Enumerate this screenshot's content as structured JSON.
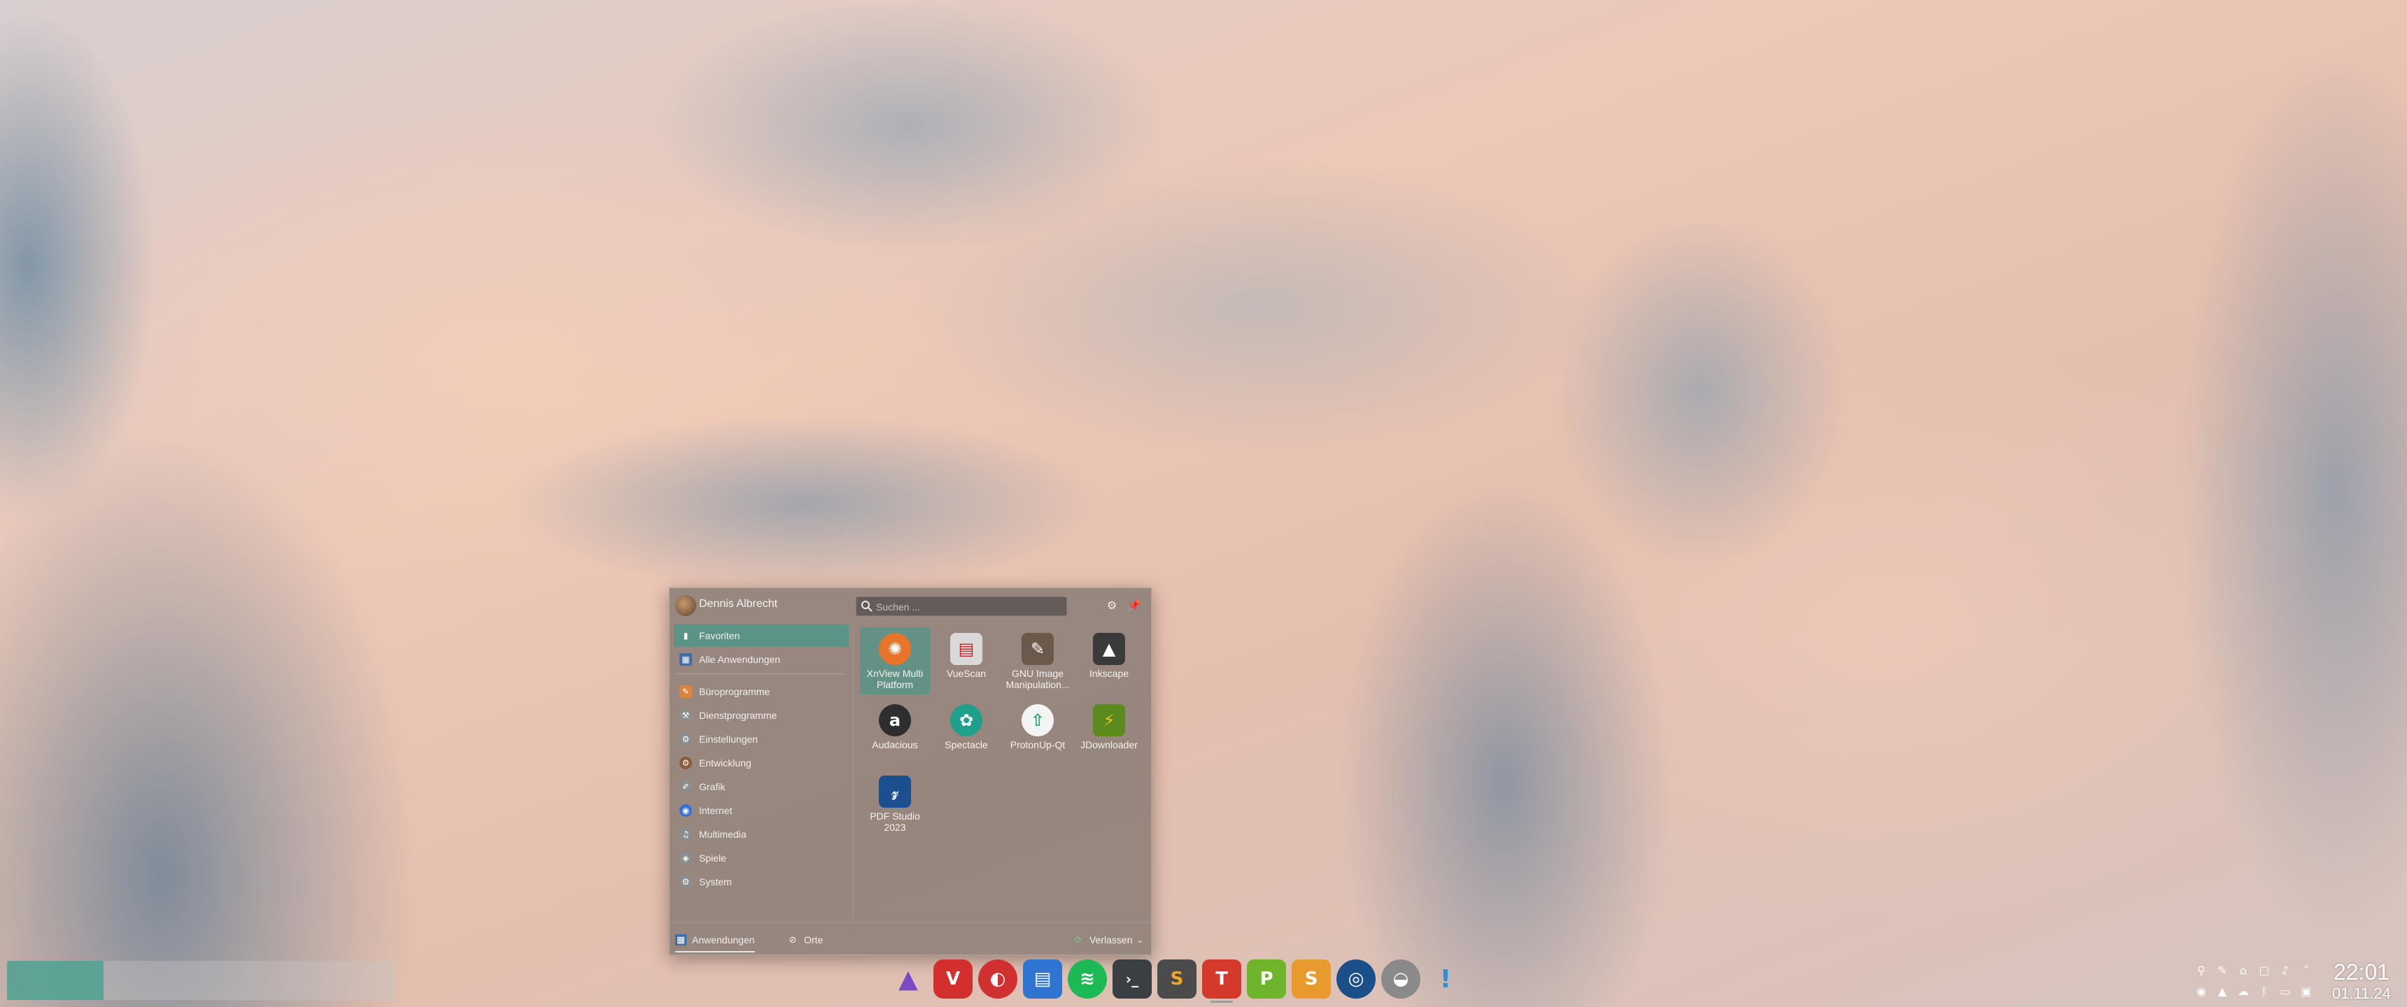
{
  "menu": {
    "user_name": "Dennis Albrecht",
    "search_placeholder": "Suchen ...",
    "header_buttons": [
      {
        "icon": "gear-icon"
      },
      {
        "icon": "pin-icon"
      }
    ],
    "categories": [
      {
        "label": "Favoriten",
        "icon": "bookmark-icon",
        "color": "#ffffff",
        "selected": true
      },
      {
        "label": "Alle Anwendungen",
        "icon": "grid-icon",
        "color": "#3d6fa3"
      },
      {
        "label": "Büroprogramme",
        "icon": "office-icon",
        "color": "#d9853b"
      },
      {
        "label": "Dienstprogramme",
        "icon": "utilities-icon",
        "color": "#8c8c8c"
      },
      {
        "label": "Einstellungen",
        "icon": "settings-icon",
        "color": "#8c8c8c"
      },
      {
        "label": "Entwicklung",
        "icon": "development-icon",
        "color": "#8a5a3c"
      },
      {
        "label": "Grafik",
        "icon": "graphics-icon",
        "color": "#8c8c8c"
      },
      {
        "label": "Internet",
        "icon": "internet-icon",
        "color": "#3a6fd6"
      },
      {
        "label": "Multimedia",
        "icon": "multimedia-icon",
        "color": "#8c8c8c"
      },
      {
        "label": "Spiele",
        "icon": "games-icon",
        "color": "#8c8c8c"
      },
      {
        "label": "System",
        "icon": "system-icon",
        "color": "#8c8c8c"
      }
    ],
    "apps": [
      {
        "label": "XnView Multi Platform",
        "icon": "xnview-icon",
        "color": "#e8742b",
        "selected": true
      },
      {
        "label": "VueScan",
        "icon": "vuescan-icon",
        "color": "#d9d9d9"
      },
      {
        "label": "GNU Image Manipulation...",
        "icon": "gimp-icon",
        "color": "#6b5a4a"
      },
      {
        "label": "Inkscape",
        "icon": "inkscape-icon",
        "color": "#3a3a3a"
      },
      {
        "label": "Audacious",
        "icon": "audacious-icon",
        "color": "#2e2e2e"
      },
      {
        "label": "Spectacle",
        "icon": "spectacle-icon",
        "color": "#1fa08a"
      },
      {
        "label": "ProtonUp-Qt",
        "icon": "protonup-icon",
        "color": "#2aa86a"
      },
      {
        "label": "JDownloader",
        "icon": "jdownloader-icon",
        "color": "#f0c419"
      },
      {
        "label": "PDF Studio 2023",
        "icon": "pdfstudio-icon",
        "color": "#1c4f8f"
      }
    ],
    "footer": {
      "applications_tab": "Anwendungen",
      "places_tab": "Orte",
      "leave_button": "Verlassen"
    }
  },
  "taskbar": {
    "apps": [
      {
        "name": "triangle-launcher-icon",
        "color": "#6b3fa0",
        "glyph": "▲"
      },
      {
        "name": "vivaldi-icon",
        "color": "#d32f2f",
        "glyph": "V"
      },
      {
        "name": "davinci-icon",
        "color": "#d03030",
        "glyph": "◐"
      },
      {
        "name": "files-icon",
        "color": "#2f74d0",
        "glyph": "▤"
      },
      {
        "name": "spotify-icon",
        "color": "#1db954",
        "glyph": "≋"
      },
      {
        "name": "terminal-icon",
        "color": "#3a3f44",
        "glyph": "›_"
      },
      {
        "name": "sublime-icon",
        "color": "#4b4b4b",
        "glyph": "S"
      },
      {
        "name": "textmaker-icon",
        "color": "#d33a2c",
        "glyph": "T"
      },
      {
        "name": "planmaker-icon",
        "color": "#6fb52c",
        "glyph": "P"
      },
      {
        "name": "presentations-icon",
        "color": "#e89a2c",
        "glyph": "S"
      },
      {
        "name": "steam-icon",
        "color": "#1b4f8a",
        "glyph": "◎"
      },
      {
        "name": "blender-icon",
        "color": "#8a8a8a",
        "glyph": "◒"
      },
      {
        "name": "mixer-icon",
        "color": "#2f8fd6",
        "glyph": "!"
      }
    ]
  },
  "tray": {
    "icons": [
      "pin-icon",
      "tools-icon",
      "network-icon",
      "clipboard-icon",
      "volume-icon",
      "expand-icon",
      "steam-tray-icon",
      "updates-icon",
      "cloud-icon",
      "bluetooth-icon",
      "battery-icon",
      "display-icon"
    ]
  },
  "clock": {
    "time": "22:01",
    "date": "01.11.24"
  }
}
